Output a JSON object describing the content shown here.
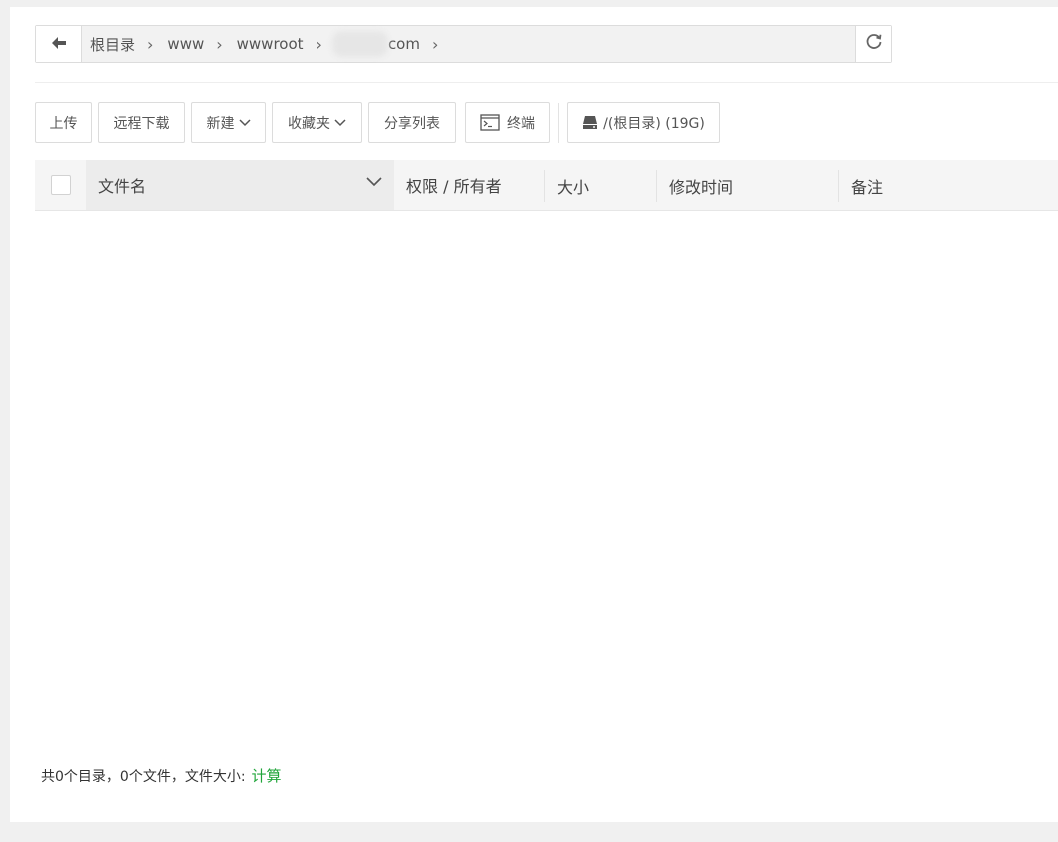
{
  "breadcrumb": {
    "items": [
      {
        "label": "根目录"
      },
      {
        "label": "www"
      },
      {
        "label": "wwwroot"
      },
      {
        "label": "com"
      }
    ]
  },
  "toolbar": {
    "upload": "上传",
    "remote_download": "远程下载",
    "new": "新建",
    "favorites": "收藏夹",
    "share_list": "分享列表",
    "terminal": "终端",
    "disk": "/(根目录) (19G)"
  },
  "table": {
    "columns": {
      "name": "文件名",
      "perm_owner": "权限 / 所有者",
      "size": "大小",
      "mtime": "修改时间",
      "note": "备注"
    },
    "rows": []
  },
  "footer": {
    "summary": "共0个目录，0个文件，文件大小:",
    "calc_link": "计算"
  },
  "colors": {
    "accent": "#20a53a",
    "header_bg": "#f5f5f5",
    "crumb_bg": "#f2f2f2"
  },
  "icons": {
    "back": "arrow-left-icon",
    "refresh": "refresh-icon",
    "terminal": "terminal-icon",
    "disk": "hard-drive-icon",
    "sort": "chevron-down-icon"
  }
}
